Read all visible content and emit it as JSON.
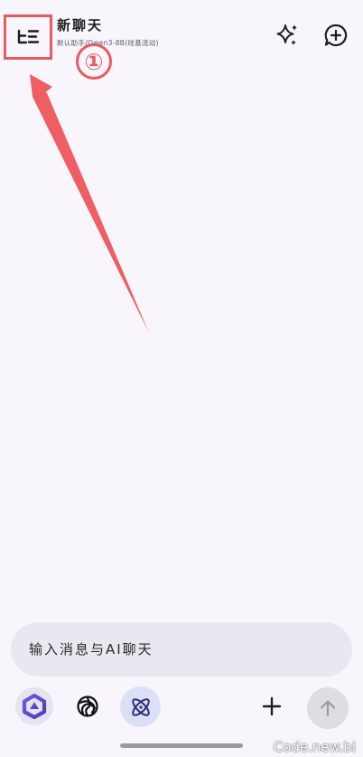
{
  "header": {
    "title": "新聊天",
    "subtitle": "默认助手/Qwen3-8B(硅基流动)",
    "annotation_number": "①"
  },
  "icons": {
    "menu": "sidebar-menu-icon",
    "sparkle": "sparkle-icon",
    "new_chat": "chat-plus-icon",
    "model_1": "qwen-logo-icon",
    "model_2": "knot-logo-icon",
    "model_3": "atom-logo-icon",
    "attach": "plus-icon",
    "send": "arrow-up-icon"
  },
  "composer": {
    "placeholder": "输入消息与AI聊天"
  },
  "watermark": "Code.new.bi",
  "colors": {
    "background": "#F8F6FC",
    "annotation": "#E85A5F",
    "input_bg": "#E8E8F0",
    "send_bg": "#DDDDE2",
    "accent": "#5B5FC7"
  }
}
